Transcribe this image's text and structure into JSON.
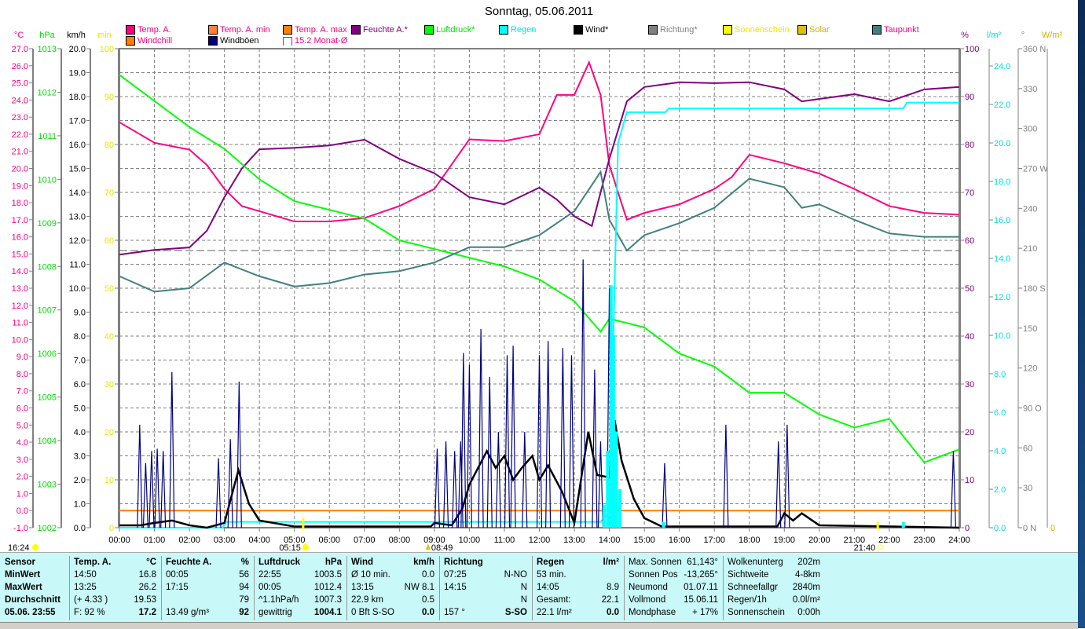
{
  "title": "Sonntag, 05.06.2011",
  "legend": [
    {
      "label": "Temp. A.",
      "color": "#ff0080",
      "text": "#ff0080"
    },
    {
      "label": "Temp. A. min",
      "color": "#ff8040",
      "text": "#ff0080"
    },
    {
      "label": "Temp. A. max",
      "color": "#ff8000",
      "text": "#ff0080"
    },
    {
      "label": "Feuchte A.*",
      "color": "#800080",
      "text": "#800080"
    },
    {
      "label": "Luftdruck*",
      "color": "#00ff00",
      "text": "#00e000"
    },
    {
      "label": "Regen",
      "color": "#00ffff",
      "text": "#00e0e0"
    },
    {
      "label": "Wind*",
      "color": "#000000",
      "text": "#000"
    },
    {
      "label": "Richtung*",
      "color": "#808080",
      "text": "#808080"
    },
    {
      "label": "Sonnenschein",
      "color": "#ffff00",
      "text": "#e8e800"
    },
    {
      "label": "Solar",
      "color": "#e0c000",
      "text": "#d0b000"
    },
    {
      "label": "Taupunkt",
      "color": "#408080",
      "text": "#ff0080"
    },
    {
      "label": "Windchill",
      "color": "#ff8000",
      "text": "#ff0080"
    },
    {
      "label": "Windböen",
      "color": "#000080",
      "text": "#000"
    },
    {
      "label": "15.2 Monat-Ø",
      "color": "#ffffff",
      "text": "#ff0080"
    }
  ],
  "axes": {
    "left": [
      {
        "unit": "°C",
        "color": "#ff0080",
        "min": -1,
        "max": 27,
        "step": 1,
        "dec": 1
      },
      {
        "unit": "hPa",
        "color": "#00e000",
        "min": 1002,
        "max": 1013,
        "step": 1,
        "dec": 0
      },
      {
        "unit": "km/h",
        "color": "#000000",
        "min": 0,
        "max": 20,
        "step": 1,
        "dec": 1
      },
      {
        "unit": "min",
        "color": "#e8e800",
        "min": 0,
        "max": 100,
        "step": 10,
        "dec": 0
      }
    ],
    "right": [
      {
        "unit": "%",
        "color": "#800080",
        "min": 0,
        "max": 100,
        "step": 10,
        "dec": 0
      },
      {
        "unit": "l/m²",
        "color": "#00e0e0",
        "min": 0,
        "max": 24.9,
        "step": 2,
        "dec": 1
      },
      {
        "unit": "°",
        "color": "#808080",
        "min": 0,
        "max": 360,
        "step": 30,
        "dec": 0,
        "dirs": {
          "0": "N",
          "90": "O",
          "180": "S",
          "270": "W",
          "360": "N"
        }
      },
      {
        "unit": "W/m²",
        "color": "#d0b000",
        "min": 0,
        "max": 0,
        "step": 1,
        "dec": 0
      }
    ]
  },
  "markers": {
    "moon": "16:24",
    "sunrise": "05:15",
    "noon": "08:49",
    "sunset": "21:40"
  },
  "chart_data": {
    "type": "line",
    "xlabel": "",
    "x_ticks": [
      "00:00",
      "01:00",
      "02:00",
      "03:00",
      "04:00",
      "05:00",
      "06:00",
      "07:00",
      "08:00",
      "09:00",
      "10:00",
      "11:00",
      "12:00",
      "13:00",
      "14:00",
      "15:00",
      "16:00",
      "17:00",
      "18:00",
      "19:00",
      "20:00",
      "21:00",
      "22:00",
      "23:00",
      "24:00"
    ],
    "month_avg_temp": 15.2,
    "series": [
      {
        "name": "Temp. A.",
        "axis": "°C",
        "color": "#ff0080",
        "points": [
          [
            0,
            22.7
          ],
          [
            1,
            21.5
          ],
          [
            2,
            21.1
          ],
          [
            2.5,
            20.2
          ],
          [
            3,
            18.8
          ],
          [
            3.5,
            17.8
          ],
          [
            4,
            17.5
          ],
          [
            5,
            16.9
          ],
          [
            6,
            16.9
          ],
          [
            7,
            17.1
          ],
          [
            8,
            17.8
          ],
          [
            9,
            18.8
          ],
          [
            10,
            21.7
          ],
          [
            11,
            21.6
          ],
          [
            12,
            22.0
          ],
          [
            12.5,
            24.3
          ],
          [
            13,
            24.3
          ],
          [
            13.42,
            26.2
          ],
          [
            13.75,
            24.3
          ],
          [
            14,
            20.2
          ],
          [
            14.5,
            17.0
          ],
          [
            15,
            17.4
          ],
          [
            16,
            17.9
          ],
          [
            17,
            18.8
          ],
          [
            17.5,
            19.5
          ],
          [
            18,
            20.8
          ],
          [
            19,
            20.3
          ],
          [
            20,
            19.7
          ],
          [
            21,
            18.8
          ],
          [
            22,
            17.8
          ],
          [
            23,
            17.4
          ],
          [
            24,
            17.3
          ]
        ]
      },
      {
        "name": "Feuchte A.",
        "axis": "%",
        "color": "#800080",
        "points": [
          [
            0,
            57
          ],
          [
            1,
            58
          ],
          [
            2,
            58.5
          ],
          [
            2.5,
            62
          ],
          [
            3,
            69
          ],
          [
            3.5,
            75
          ],
          [
            4,
            79
          ],
          [
            5,
            79.3
          ],
          [
            6,
            79.8
          ],
          [
            7,
            81
          ],
          [
            7.5,
            79
          ],
          [
            8,
            77
          ],
          [
            9,
            74
          ],
          [
            10,
            69
          ],
          [
            11,
            67.5
          ],
          [
            12,
            71
          ],
          [
            12.5,
            68.5
          ],
          [
            13,
            65
          ],
          [
            13.5,
            63
          ],
          [
            14,
            77
          ],
          [
            14.5,
            89
          ],
          [
            15,
            92
          ],
          [
            16,
            93
          ],
          [
            17,
            92.8
          ],
          [
            18,
            93
          ],
          [
            19,
            91.5
          ],
          [
            19.5,
            89
          ],
          [
            20,
            89.5
          ],
          [
            21,
            90.5
          ],
          [
            22,
            89
          ],
          [
            23,
            91.5
          ],
          [
            24,
            92
          ]
        ]
      },
      {
        "name": "Luftdruck",
        "axis": "hPa",
        "color": "#00ff00",
        "points": [
          [
            0,
            1012.4
          ],
          [
            1,
            1011.8
          ],
          [
            2,
            1011.2
          ],
          [
            3,
            1010.7
          ],
          [
            4,
            1010.0
          ],
          [
            5,
            1009.5
          ],
          [
            6,
            1009.3
          ],
          [
            7,
            1009.1
          ],
          [
            8,
            1008.6
          ],
          [
            9,
            1008.4
          ],
          [
            10,
            1008.2
          ],
          [
            11,
            1008.0
          ],
          [
            12,
            1007.7
          ],
          [
            13,
            1007.2
          ],
          [
            13.75,
            1006.5
          ],
          [
            14,
            1006.8
          ],
          [
            15,
            1006.6
          ],
          [
            16,
            1006.0
          ],
          [
            17,
            1005.7
          ],
          [
            18,
            1005.1
          ],
          [
            19,
            1005.1
          ],
          [
            20,
            1004.6
          ],
          [
            21,
            1004.3
          ],
          [
            22,
            1004.5
          ],
          [
            23,
            1003.5
          ],
          [
            24,
            1003.8
          ]
        ]
      },
      {
        "name": "Taupunkt",
        "axis": "°C",
        "color": "#408080",
        "points": [
          [
            0,
            13.7
          ],
          [
            1,
            12.8
          ],
          [
            2,
            13.0
          ],
          [
            3,
            14.5
          ],
          [
            4,
            13.7
          ],
          [
            5,
            13.1
          ],
          [
            6,
            13.3
          ],
          [
            7,
            13.8
          ],
          [
            8,
            14.0
          ],
          [
            9,
            14.5
          ],
          [
            10,
            15.4
          ],
          [
            11,
            15.4
          ],
          [
            12,
            16.1
          ],
          [
            13,
            17.5
          ],
          [
            13.75,
            19.8
          ],
          [
            14,
            17.0
          ],
          [
            14.5,
            15.2
          ],
          [
            15,
            16.1
          ],
          [
            16,
            16.8
          ],
          [
            17,
            17.7
          ],
          [
            18,
            19.4
          ],
          [
            19,
            18.9
          ],
          [
            19.5,
            17.7
          ],
          [
            20,
            17.9
          ],
          [
            21,
            17.0
          ],
          [
            22,
            16.2
          ],
          [
            23,
            16.0
          ],
          [
            24,
            16.0
          ]
        ]
      },
      {
        "name": "Regen",
        "axis": "l/m²",
        "color": "#00ffff",
        "points": [
          [
            0,
            0
          ],
          [
            2.95,
            0
          ],
          [
            3.05,
            0.3
          ],
          [
            13.75,
            0.3
          ],
          [
            14,
            0.8
          ],
          [
            14.1,
            8.9
          ],
          [
            14.25,
            20
          ],
          [
            14.5,
            21.6
          ],
          [
            15,
            21.6
          ],
          [
            15.6,
            21.6
          ],
          [
            15.7,
            21.8
          ],
          [
            22.4,
            21.8
          ],
          [
            22.5,
            22.1
          ],
          [
            24,
            22.1
          ]
        ]
      },
      {
        "name": "Wind",
        "axis": "km/h",
        "color": "#000000",
        "points": [
          [
            0,
            0.1
          ],
          [
            0.6,
            0.1
          ],
          [
            1,
            0.2
          ],
          [
            1.5,
            0.3
          ],
          [
            2,
            0.1
          ],
          [
            2.5,
            0
          ],
          [
            3,
            0.2
          ],
          [
            3.4,
            2.4
          ],
          [
            3.7,
            1.0
          ],
          [
            4,
            0.3
          ],
          [
            5,
            0.05
          ],
          [
            8.9,
            0.05
          ],
          [
            9,
            0.2
          ],
          [
            9.5,
            0.1
          ],
          [
            9.8,
            0.8
          ],
          [
            10,
            1.8
          ],
          [
            10.5,
            3.2
          ],
          [
            10.75,
            2.5
          ],
          [
            11,
            3.0
          ],
          [
            11.25,
            2.0
          ],
          [
            11.5,
            2.5
          ],
          [
            11.8,
            3.0
          ],
          [
            12,
            2.0
          ],
          [
            12.25,
            2.6
          ],
          [
            12.65,
            1.5
          ],
          [
            13,
            0.2
          ],
          [
            13.4,
            4.0
          ],
          [
            13.65,
            2.2
          ],
          [
            14,
            2.1
          ],
          [
            14.15,
            4.5
          ],
          [
            14.35,
            2.8
          ],
          [
            14.7,
            1.2
          ],
          [
            15,
            0.4
          ],
          [
            15.5,
            0.05
          ],
          [
            18.8,
            0.05
          ],
          [
            19,
            0.6
          ],
          [
            19.25,
            0.3
          ],
          [
            19.5,
            0.6
          ],
          [
            20,
            0.1
          ],
          [
            24,
            0
          ]
        ]
      },
      {
        "name": "Windböen",
        "axis": "km/h",
        "color": "#000080",
        "spikes": [
          [
            0.58,
            4.3
          ],
          [
            0.75,
            2.7
          ],
          [
            0.92,
            3.2
          ],
          [
            1.08,
            3.3
          ],
          [
            1.25,
            3.2
          ],
          [
            1.5,
            6.5
          ],
          [
            2.83,
            2.9
          ],
          [
            3.17,
            3.7
          ],
          [
            3.42,
            6.1
          ],
          [
            9.08,
            3.3
          ],
          [
            9.33,
            3.6
          ],
          [
            9.58,
            3.2
          ],
          [
            9.75,
            3.6
          ],
          [
            9.83,
            7.3
          ],
          [
            10.0,
            6.8
          ],
          [
            10.33,
            8.3
          ],
          [
            10.58,
            6.3
          ],
          [
            10.83,
            4.0
          ],
          [
            11.08,
            7.2
          ],
          [
            11.25,
            7.6
          ],
          [
            11.58,
            4.0
          ],
          [
            12.0,
            7.2
          ],
          [
            12.25,
            7.8
          ],
          [
            12.67,
            7.5
          ],
          [
            12.92,
            7.2
          ],
          [
            13.25,
            11.2
          ],
          [
            13.58,
            6.6
          ],
          [
            13.75,
            3.6
          ],
          [
            14.0,
            10.0
          ],
          [
            15.58,
            2.7
          ],
          [
            17.33,
            4.3
          ],
          [
            18.83,
            3.6
          ],
          [
            19.08,
            4.3
          ],
          [
            23.83,
            3.2
          ]
        ]
      },
      {
        "name": "Regen/h",
        "axis": "l/m²",
        "color": "#00ffff",
        "bars": [
          [
            13.85,
            1.2
          ],
          [
            13.95,
            4
          ],
          [
            14.05,
            12.6
          ],
          [
            14.12,
            10
          ],
          [
            14.2,
            5
          ],
          [
            14.3,
            2
          ],
          [
            15.55,
            0.3
          ],
          [
            22.4,
            0.3
          ]
        ]
      }
    ]
  },
  "table": {
    "sensor": {
      "h": "Sensor",
      "rows": [
        "MinWert",
        "MaxWert",
        "Durchschnitt",
        "05.06. 23:55"
      ]
    },
    "temp": {
      "h": "Temp. A.",
      "u": "°C",
      "rows": [
        [
          "14:50",
          "16.8"
        ],
        [
          "13:25",
          "26.2"
        ],
        [
          "(+ 4.33 )",
          "19.53"
        ],
        [
          "F: 92 %",
          "17.2"
        ]
      ]
    },
    "hum": {
      "h": "Feuchte A.",
      "u": "%",
      "rows": [
        [
          "00:05",
          "56"
        ],
        [
          "17:15",
          "94"
        ],
        [
          "",
          "79"
        ],
        [
          "13.49 g/m³",
          "92"
        ]
      ]
    },
    "press": {
      "h": "Luftdruck",
      "u": "hPa",
      "rows": [
        [
          "22:55",
          "1003.5"
        ],
        [
          "00:05",
          "1012.4"
        ],
        [
          "^1.1hPa/h",
          "1007.3"
        ],
        [
          "gewittrig",
          "1004.1"
        ]
      ]
    },
    "wind": {
      "h": "Wind",
      "u": "km/h",
      "rows": [
        [
          "Ø 10 min.",
          "0.0"
        ],
        [
          "13:15",
          "NW 8.1"
        ],
        [
          "22.9 km",
          "0.5"
        ],
        [
          "0 Bft S-SO",
          "0.0"
        ]
      ]
    },
    "dir": {
      "h": "Richtung",
      "u": "",
      "rows": [
        [
          "07:25",
          "N-NO"
        ],
        [
          "14:15",
          "N"
        ],
        [
          "",
          "N"
        ],
        [
          "157 °",
          "S-SO"
        ]
      ]
    },
    "rain": {
      "h": "Regen",
      "u": "l/m²",
      "rows": [
        [
          "53 min.",
          ""
        ],
        [
          "14:05",
          "8.9"
        ],
        [
          "Gesamt:",
          "22.1"
        ],
        [
          "22.1 l/m²",
          "0.0"
        ]
      ]
    },
    "sun": {
      "rows": [
        [
          "Max. Sonnen",
          "61,143°"
        ],
        [
          "Sonnen Pos",
          "-13,265°"
        ],
        [
          "Neumond",
          "01.07.11"
        ],
        [
          "Vollmond",
          "15.06.11"
        ],
        [
          "Mondphase",
          "+ 17%"
        ]
      ]
    },
    "misc": {
      "rows": [
        [
          "Wolkenunterg",
          "202m"
        ],
        [
          "Sichtweite",
          "4-8km"
        ],
        [
          "Schneefallgr",
          "2840m"
        ],
        [
          "Regen/1h",
          "0.0l/m²"
        ],
        [
          "Sonnenschein",
          "0:00h"
        ]
      ]
    }
  }
}
